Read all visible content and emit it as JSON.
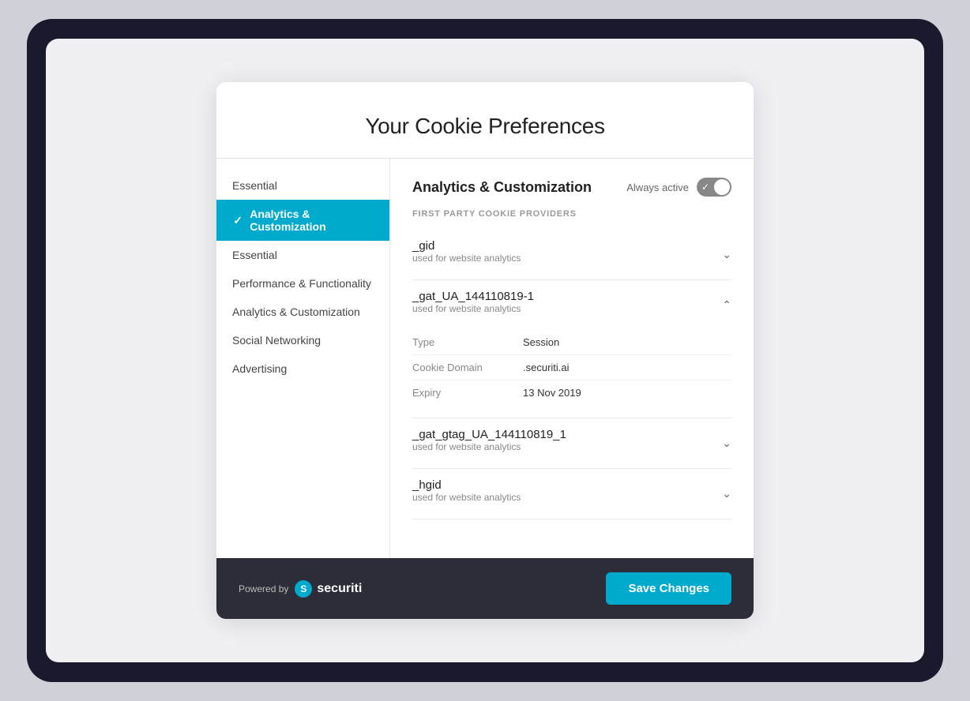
{
  "modal": {
    "title": "Your Cookie Preferences"
  },
  "sidebar": {
    "items": [
      {
        "id": "essential-top",
        "label": "Essential",
        "active": false
      },
      {
        "id": "analytics-customization",
        "label": "Analytics & Customization",
        "active": true
      },
      {
        "id": "essential",
        "label": "Essential",
        "active": false
      },
      {
        "id": "performance-functionality",
        "label": "Performance & Functionality",
        "active": false
      },
      {
        "id": "analytics-customization-2",
        "label": "Analytics & Customization",
        "active": false
      },
      {
        "id": "social-networking",
        "label": "Social Networking",
        "active": false
      },
      {
        "id": "advertising",
        "label": "Advertising",
        "active": false
      }
    ]
  },
  "main": {
    "section_title": "Analytics & Customization",
    "always_active_label": "Always active",
    "providers_label": "FIRST PARTY COOKIE PROVIDERS",
    "cookies": [
      {
        "id": "gid",
        "name": "_gid",
        "description": "used for website analytics",
        "expanded": false,
        "details": []
      },
      {
        "id": "gat_ua",
        "name": "_gat_UA_144110819-1",
        "description": "used for website analytics",
        "expanded": true,
        "details": [
          {
            "label": "Type",
            "value": "Session"
          },
          {
            "label": "Cookie Domain",
            "value": ".securiti.ai"
          },
          {
            "label": "Expiry",
            "value": "13 Nov 2019"
          }
        ]
      },
      {
        "id": "gat_gtag",
        "name": "_gat_gtag_UA_144110819_1",
        "description": "used for website analytics",
        "expanded": false,
        "details": []
      },
      {
        "id": "hgid",
        "name": "_hgid",
        "description": "used for website analytics",
        "expanded": false,
        "details": []
      }
    ]
  },
  "footer": {
    "powered_by": "Powered by",
    "brand_name": "securiti",
    "save_button_label": "Save Changes"
  },
  "colors": {
    "accent": "#00aacc",
    "dark_footer": "#2d2d3a"
  }
}
